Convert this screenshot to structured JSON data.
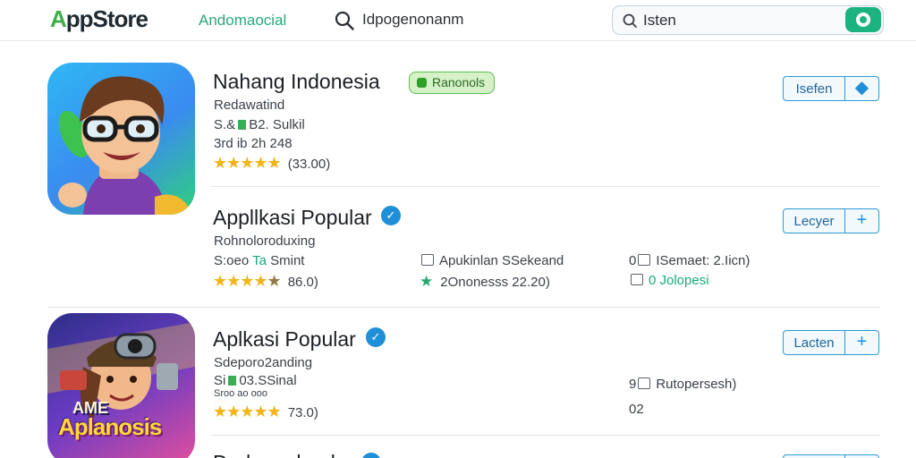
{
  "header": {
    "logo_prefix": "A",
    "logo_rest": "ppStore",
    "nav_link": "Andomaocial",
    "search_label": "Idpogenonanm",
    "search_input_value": "Isten"
  },
  "apps": [
    {
      "title": "Nahang Indonesia",
      "badge": "Ranonols",
      "subtitle": "Redawatind",
      "meta_prefix": "S.&",
      "meta_suffix": "B2. Sulkil",
      "meta2": "3rd ib 2h 248",
      "rating_text": "(33.00)",
      "rating": 5,
      "button_label": "Isefen",
      "button_icon": "◆"
    },
    {
      "title": "Appllkasi Popular",
      "subtitle": "Rohnoloroduxing",
      "meta_prefix": "S:oeo",
      "meta_teal": "Ta",
      "meta_suffix": "Smint",
      "rating_text": "86.0)",
      "rating": 4.5,
      "col2_line1": "Apukinlan SSekeand",
      "col2_line2": "2Ononesss 22.20)",
      "col3_line1": "0",
      "col3_line1_rest": "ISemaet: 2.Iicn)",
      "col3_line2_teal": "0 Jolopesi",
      "button_label": "Lecyer",
      "button_icon": "+"
    },
    {
      "title": "Aplkasi Popular",
      "subtitle": "Sdeporo2anding",
      "meta_prefix": "Si",
      "meta_suffix": "03.SSinal",
      "meta2": "Sroo ao ooo",
      "rating_text": "73.0)",
      "rating": 5,
      "col3_line1": "9",
      "col3_line1_rest": "Rutopersesh)",
      "col3_line2": "02",
      "button_label": "Lacten",
      "button_icon": "+",
      "icon_caption_top": "AME",
      "icon_caption_bottom": "Aplanosis"
    }
  ],
  "partial_row": {
    "title": "Dadaaaahaalaa"
  }
}
